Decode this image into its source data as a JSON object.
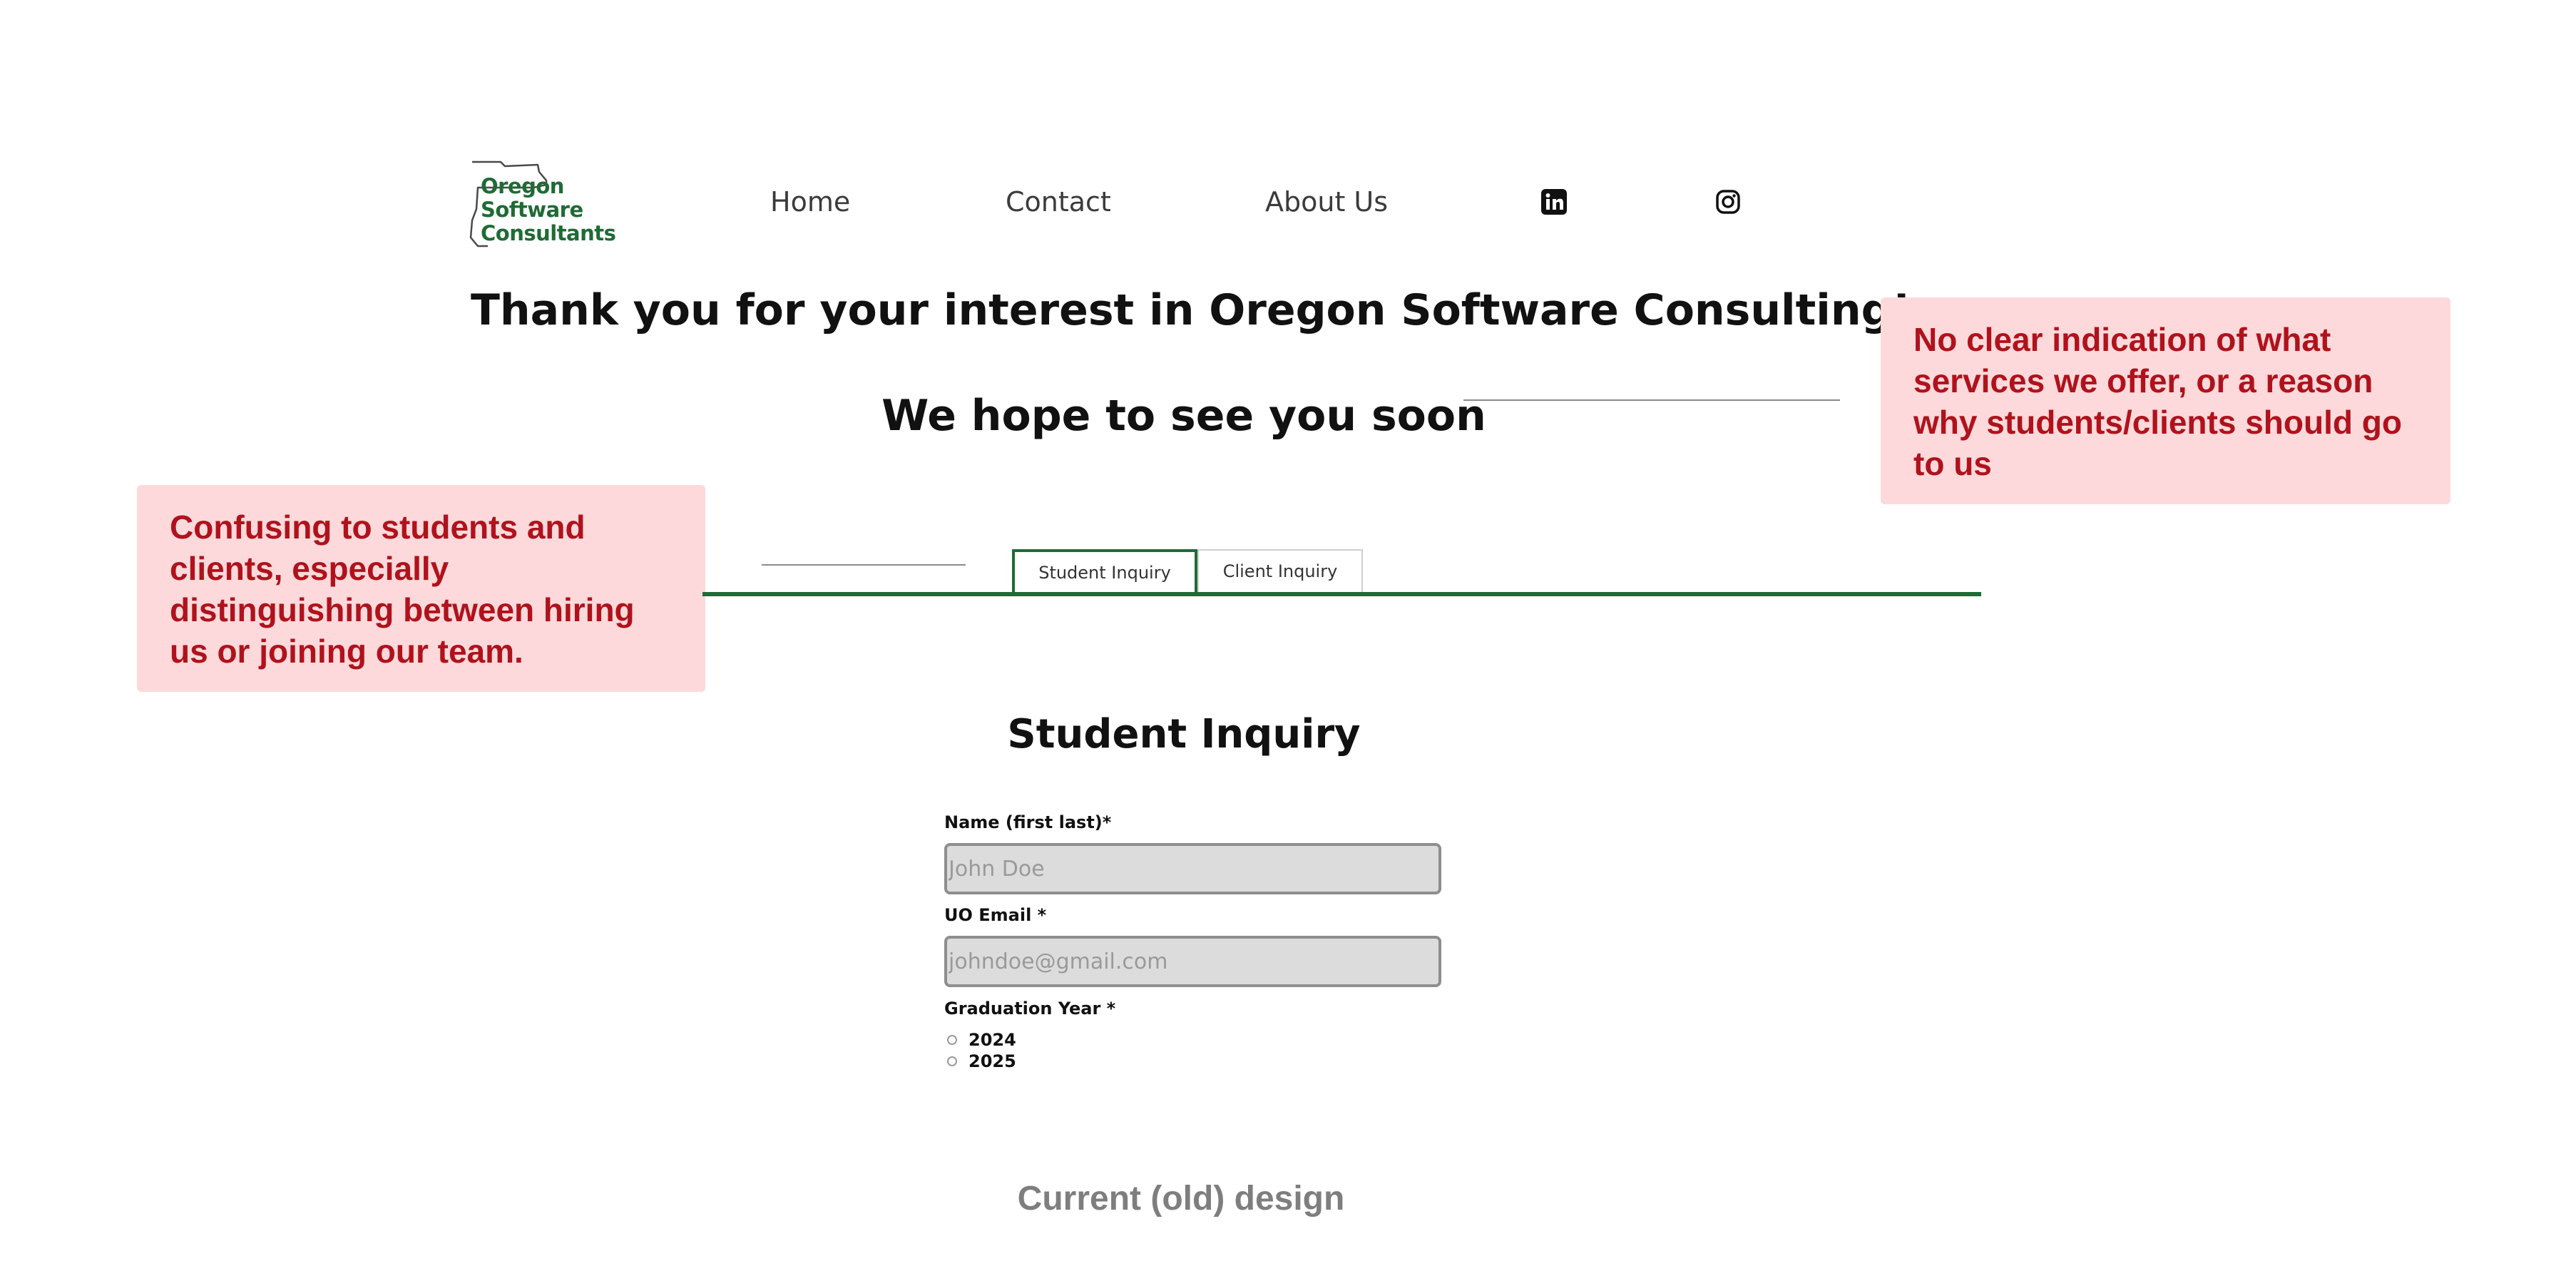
{
  "brand": {
    "logo_lines": [
      "Oregon",
      "Software",
      "Consultants"
    ],
    "color": "#1f6b35"
  },
  "nav": {
    "items": [
      "Home",
      "Contact",
      "About Us"
    ],
    "social": [
      {
        "icon": "linkedin-icon"
      },
      {
        "icon": "instagram-icon"
      }
    ]
  },
  "hero": {
    "title": "Thank you for your interest in Oregon Software Consulting!",
    "subtitle": "We hope to see you soon"
  },
  "tabs": {
    "items": [
      "Student Inquiry",
      "Client Inquiry"
    ],
    "active": "Student Inquiry"
  },
  "form": {
    "title": "Student Inquiry",
    "name_label": "Name (first last)*",
    "name_placeholder": "John Doe",
    "email_label": "UO Email *",
    "email_placeholder": "johndoe@gmail.com",
    "grad_label": "Graduation Year *",
    "grad_options": [
      "2024",
      "2025"
    ]
  },
  "annotations": {
    "right": "No clear indication of what services we offer, or a reason why students/clients should go to us",
    "left": "Confusing to students and clients, especially distinguishing between hiring us or joining our team.",
    "color": "#b0121c",
    "background": "#fdd9db"
  },
  "caption": "Current (old) design"
}
